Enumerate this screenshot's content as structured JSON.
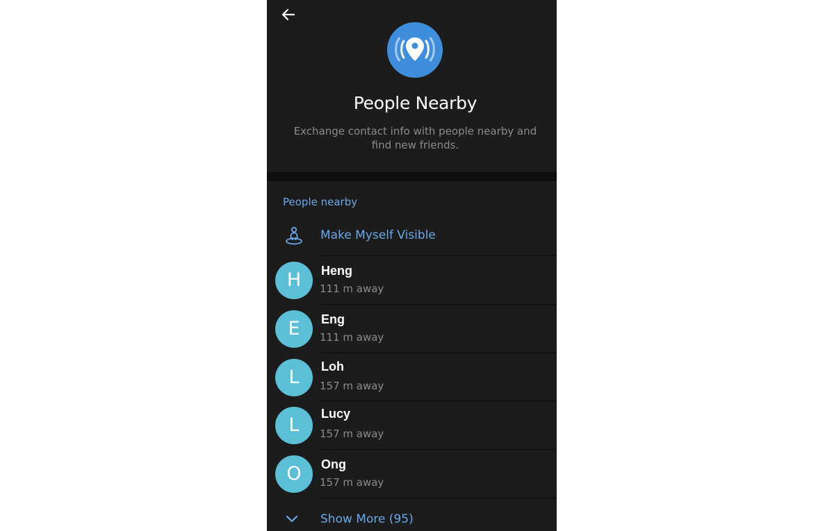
{
  "header": {
    "title": "People Nearby",
    "subtitle": "Exchange contact info with people nearby and find new friends.",
    "back_icon": "arrow-left-icon",
    "hero_icon": "location-broadcast-icon"
  },
  "section": {
    "title": "People nearby"
  },
  "make_visible": {
    "label": "Make Myself Visible",
    "icon": "person-on-pin-icon"
  },
  "people": [
    {
      "initial": "H",
      "name": "Heng",
      "distance": "111 m away"
    },
    {
      "initial": "E",
      "name": "Eng",
      "distance": "111 m away"
    },
    {
      "initial": "L",
      "name": "Loh",
      "distance": "157 m away"
    },
    {
      "initial": "L",
      "name": "Lucy",
      "distance": "157 m away"
    },
    {
      "initial": "O",
      "name": "Ong",
      "distance": "157 m away"
    }
  ],
  "show_more": {
    "label": "Show More (95)",
    "icon": "chevron-down-icon"
  },
  "colors": {
    "background": "#1c1c1d",
    "accent": "#6aa9e9",
    "hero": "#3f8edc",
    "avatar": "#5bbfd6",
    "secondary_text": "#8b8b8f"
  }
}
